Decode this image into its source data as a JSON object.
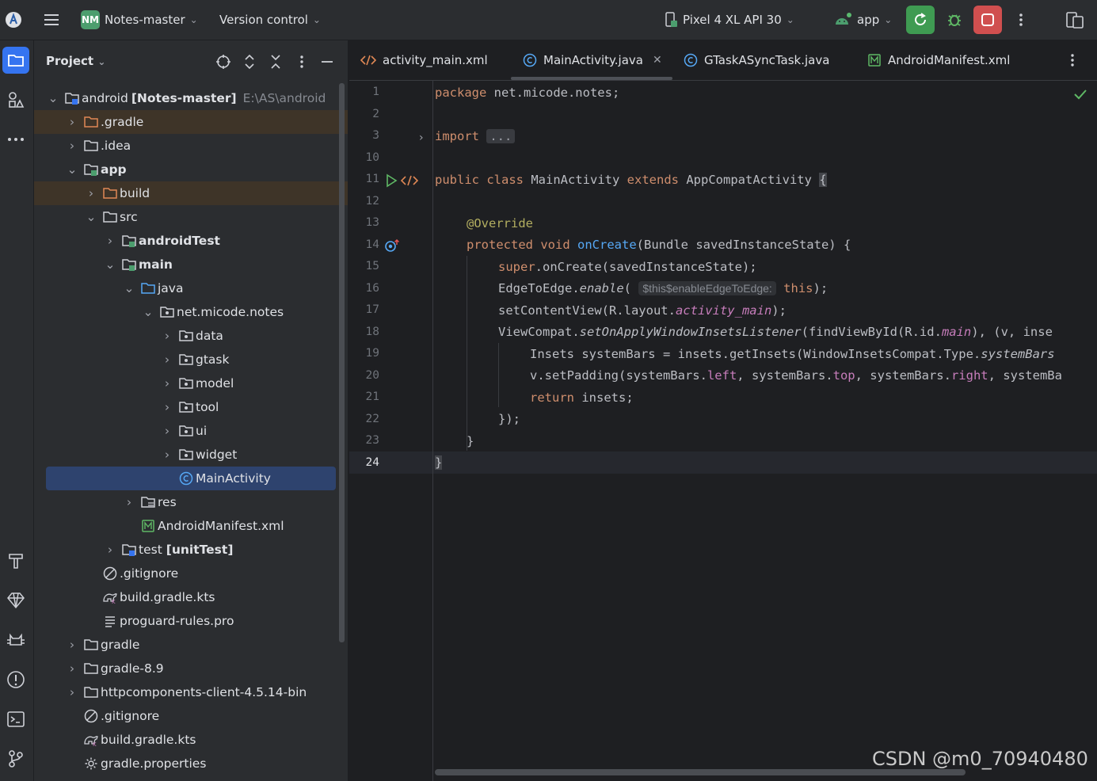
{
  "topbar": {
    "project_badge": "NM",
    "project_name": "Notes-master",
    "vcs": "Version control",
    "device": "Pixel 4 XL API 30",
    "run_config": "app"
  },
  "project_panel": {
    "title": "Project",
    "tree": [
      {
        "name": "android",
        "bold_suffix": "[Notes-master]",
        "hint": "E:\\AS\\android"
      },
      {
        "name": ".gradle"
      },
      {
        "name": ".idea"
      },
      {
        "name": "app"
      },
      {
        "name": "build"
      },
      {
        "name": "src"
      },
      {
        "name": "androidTest"
      },
      {
        "name": "main"
      },
      {
        "name": "java"
      },
      {
        "name": "net.micode.notes"
      },
      {
        "name": "data"
      },
      {
        "name": "gtask"
      },
      {
        "name": "model"
      },
      {
        "name": "tool"
      },
      {
        "name": "ui"
      },
      {
        "name": "widget"
      },
      {
        "name": "MainActivity"
      },
      {
        "name": "res"
      },
      {
        "name": "AndroidManifest.xml"
      },
      {
        "name": "test",
        "bold_suffix": "[unitTest]"
      },
      {
        "name": ".gitignore"
      },
      {
        "name": "build.gradle.kts"
      },
      {
        "name": "proguard-rules.pro"
      },
      {
        "name": "gradle"
      },
      {
        "name": "gradle-8.9"
      },
      {
        "name": "httpcomponents-client-4.5.14-bin"
      },
      {
        "name": ".gitignore"
      },
      {
        "name": "build.gradle.kts"
      },
      {
        "name": "gradle.properties"
      }
    ]
  },
  "editor": {
    "tabs": [
      {
        "label": "activity_main.xml"
      },
      {
        "label": "MainActivity.java"
      },
      {
        "label": "GTaskASyncTask.java"
      },
      {
        "label": "AndroidManifest.xml"
      }
    ],
    "line_numbers": [
      "1",
      "2",
      "3",
      "10",
      "11",
      "12",
      "13",
      "14",
      "15",
      "16",
      "17",
      "18",
      "19",
      "20",
      "21",
      "22",
      "23",
      "24"
    ],
    "code": {
      "l1_kw": "package",
      "l1_rest": " net.micode.notes;",
      "l3_kw": "import",
      "l3_fold": "...",
      "l11_kw1": "public",
      "l11_kw2": "class",
      "l11_name": " MainActivity ",
      "l11_kw3": "extends",
      "l11_super": " AppCompatActivity ",
      "l11_brace": "{",
      "l13_ann": "@Override",
      "l14_kw1": "protected",
      "l14_kw2": "void",
      "l14_fn": "onCreate",
      "l14_rest": "(Bundle savedInstanceState) {",
      "l15_kw": "super",
      "l15_rest": ".onCreate(savedInstanceState);",
      "l16_a": "EdgeToEdge.",
      "l16_fn": "enable",
      "l16_b": "(",
      "l16_hint": "$this$enableEdgeToEdge:",
      "l16_kw": "this",
      "l16_c": ");",
      "l17_a": "setContentView(R.layout.",
      "l17_fld": "activity_main",
      "l17_b": ");",
      "l18_a": "ViewCompat.",
      "l18_fn": "setOnApplyWindowInsetsListener",
      "l18_b": "(findViewById(R.id.",
      "l18_fld": "main",
      "l18_c": "), (v, inse",
      "l19_a": "Insets systemBars = insets.getInsets(WindowInsetsCompat.Type.",
      "l19_fld": "systemBars",
      "l20_a": "v.setPadding(systemBars.",
      "l20_f1": "left",
      "l20_b": ", systemBars.",
      "l20_f2": "top",
      "l20_c": ", systemBars.",
      "l20_f3": "right",
      "l20_d": ", systemBa",
      "l21_kw": "return",
      "l21_rest": " insets;",
      "l22": "});",
      "l23": "}",
      "l24": "}"
    }
  },
  "watermark": "CSDN @m0_70940480"
}
